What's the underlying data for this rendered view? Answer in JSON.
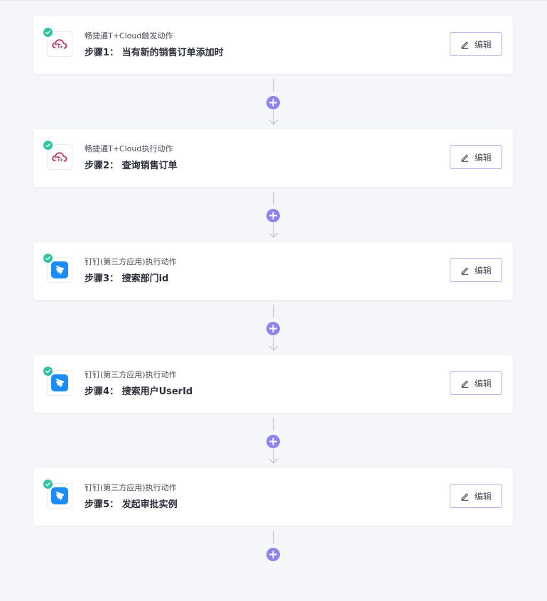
{
  "steps": [
    {
      "app": "tcloud",
      "subtitle": "畅捷通T+Cloud触发动作",
      "title": "步骤1： 当有新的销售订单添加时",
      "edit_label": "编辑"
    },
    {
      "app": "tcloud",
      "subtitle": "畅捷通T+Cloud执行动作",
      "title": "步骤2： 查询销售订单",
      "edit_label": "编辑"
    },
    {
      "app": "dingtalk",
      "subtitle": "钉钉(第三方应用)执行动作",
      "title": "步骤3： 搜索部门id",
      "edit_label": "编辑"
    },
    {
      "app": "dingtalk",
      "subtitle": "钉钉(第三方应用)执行动作",
      "title": "步骤4： 搜索用户UserId",
      "edit_label": "编辑"
    },
    {
      "app": "dingtalk",
      "subtitle": "钉钉(第三方应用)执行动作",
      "title": "步骤5： 发起审批实例",
      "edit_label": "编辑"
    }
  ],
  "icons": {
    "status": "check-icon",
    "edit": "pencil-icon",
    "add": "plus-icon",
    "arrow": "arrow-down-icon"
  },
  "colors": {
    "success": "#2ec4a5",
    "accent": "#8d85ec",
    "dingtalk": "#1a8cff",
    "tcloud_logo": "#c4365e"
  }
}
